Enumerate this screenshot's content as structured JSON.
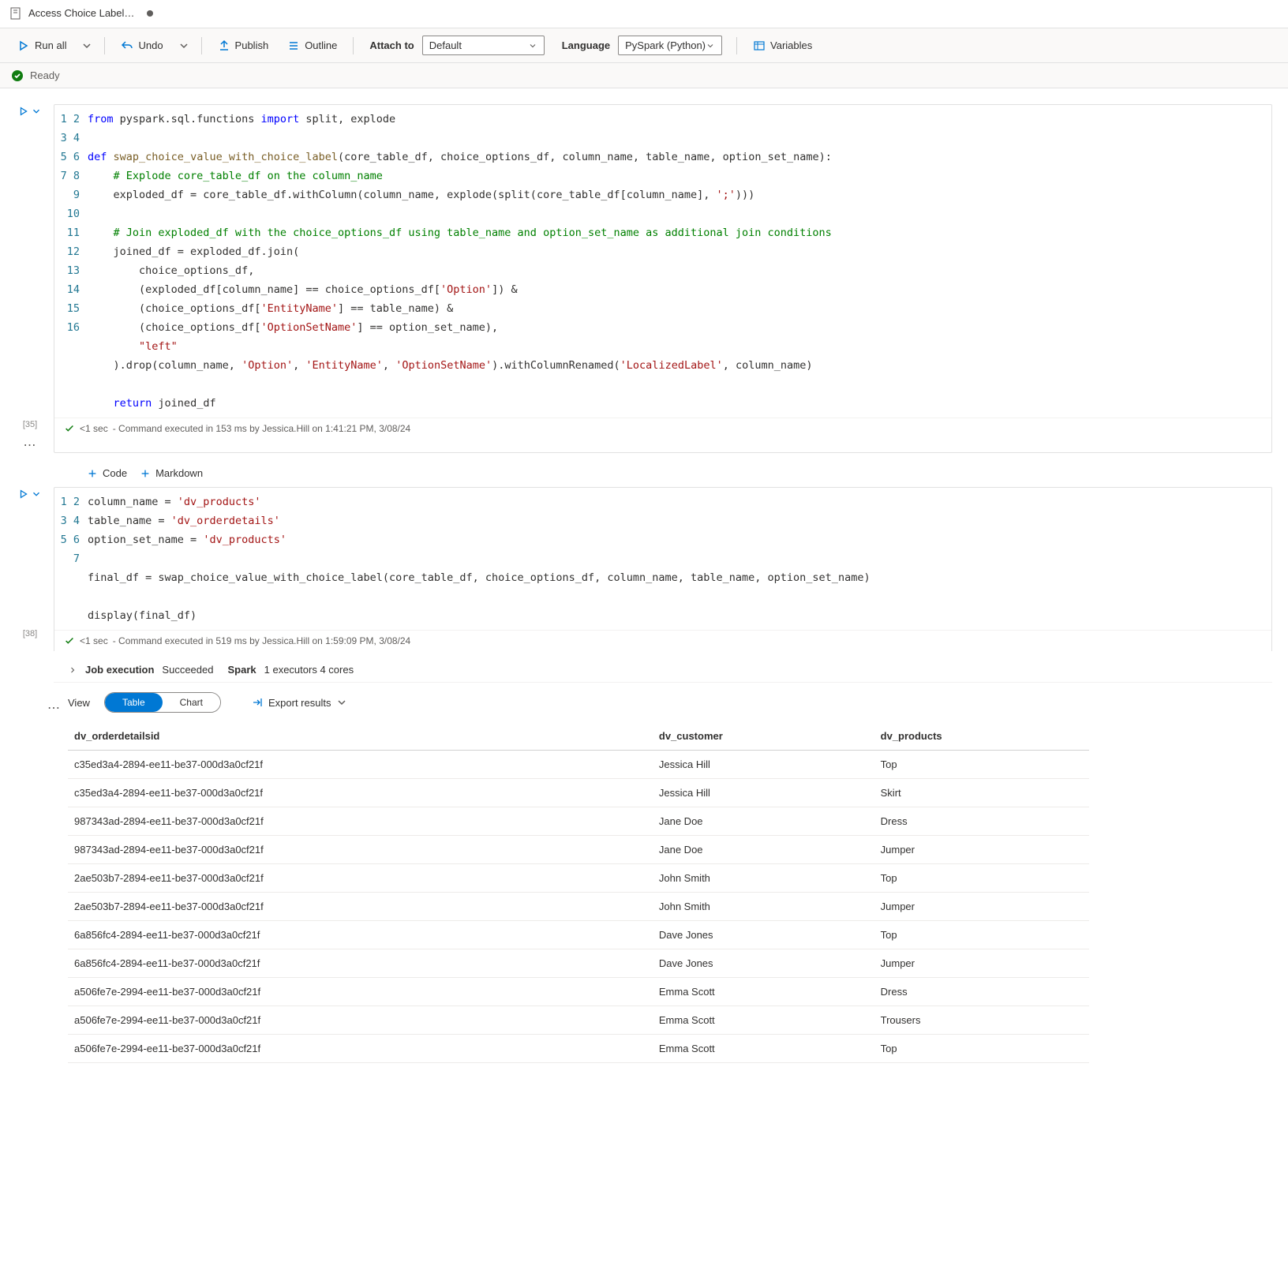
{
  "tab": {
    "title": "Access Choice Label…"
  },
  "toolbar": {
    "run_all": "Run all",
    "undo": "Undo",
    "publish": "Publish",
    "outline": "Outline",
    "attach_to_label": "Attach to",
    "attach_to_value": "Default",
    "language_label": "Language",
    "language_value": "PySpark (Python)",
    "variables": "Variables"
  },
  "status": {
    "text": "Ready"
  },
  "cell1": {
    "exec_count": "[35]",
    "lines": [
      "from pyspark.sql.functions import split, explode",
      "",
      "def swap_choice_value_with_choice_label(core_table_df, choice_options_df, column_name, table_name, option_set_name):",
      "    # Explode core_table_df on the column_name",
      "    exploded_df = core_table_df.withColumn(column_name, explode(split(core_table_df[column_name], ';')))",
      "",
      "    # Join exploded_df with the choice_options_df using table_name and option_set_name as additional join conditions",
      "    joined_df = exploded_df.join(",
      "        choice_options_df,",
      "        (exploded_df[column_name] == choice_options_df['Option']) &",
      "        (choice_options_df['EntityName'] == table_name) &",
      "        (choice_options_df['OptionSetName'] == option_set_name),",
      "        \"left\"",
      "    ).drop(column_name, 'Option', 'EntityName', 'OptionSetName').withColumnRenamed('LocalizedLabel', column_name)",
      "",
      "    return joined_df"
    ],
    "status_time": "<1 sec",
    "status_text": "- Command executed in 153 ms by Jessica.Hill on 1:41:21 PM, 3/08/24"
  },
  "add_bar": {
    "code": "Code",
    "markdown": "Markdown"
  },
  "cell2": {
    "exec_count": "[38]",
    "lines": [
      "column_name = 'dv_products'",
      "table_name = 'dv_orderdetails'",
      "option_set_name = 'dv_products'",
      "",
      "final_df = swap_choice_value_with_choice_label(core_table_df, choice_options_df, column_name, table_name, option_set_name)",
      "",
      "display(final_df)"
    ],
    "status_time": "<1 sec",
    "status_text": "- Command executed in 519 ms by Jessica.Hill on 1:59:09 PM, 3/08/24"
  },
  "job": {
    "label": "Job execution",
    "status": "Succeeded",
    "spark_label": "Spark",
    "spark_detail": "1 executors 4 cores"
  },
  "view": {
    "label": "View",
    "table": "Table",
    "chart": "Chart",
    "export": "Export results"
  },
  "table": {
    "headers": [
      "dv_orderdetailsid",
      "dv_customer",
      "dv_products"
    ],
    "rows": [
      [
        "c35ed3a4-2894-ee11-be37-000d3a0cf21f",
        "Jessica Hill",
        "Top"
      ],
      [
        "c35ed3a4-2894-ee11-be37-000d3a0cf21f",
        "Jessica Hill",
        "Skirt"
      ],
      [
        "987343ad-2894-ee11-be37-000d3a0cf21f",
        "Jane Doe",
        "Dress"
      ],
      [
        "987343ad-2894-ee11-be37-000d3a0cf21f",
        "Jane Doe",
        "Jumper"
      ],
      [
        "2ae503b7-2894-ee11-be37-000d3a0cf21f",
        "John Smith",
        "Top"
      ],
      [
        "2ae503b7-2894-ee11-be37-000d3a0cf21f",
        "John Smith",
        "Jumper"
      ],
      [
        "6a856fc4-2894-ee11-be37-000d3a0cf21f",
        "Dave Jones",
        "Top"
      ],
      [
        "6a856fc4-2894-ee11-be37-000d3a0cf21f",
        "Dave Jones",
        "Jumper"
      ],
      [
        "a506fe7e-2994-ee11-be37-000d3a0cf21f",
        "Emma Scott",
        "Dress"
      ],
      [
        "a506fe7e-2994-ee11-be37-000d3a0cf21f",
        "Emma Scott",
        "Trousers"
      ],
      [
        "a506fe7e-2994-ee11-be37-000d3a0cf21f",
        "Emma Scott",
        "Top"
      ]
    ]
  }
}
